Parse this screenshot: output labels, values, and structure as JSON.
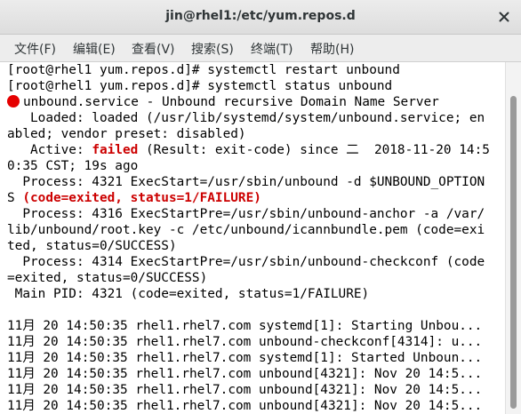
{
  "window": {
    "title": "jin@rhel1:/etc/yum.repos.d",
    "close_icon": "close-icon"
  },
  "menu": {
    "items": [
      "文件(F)",
      "编辑(E)",
      "查看(V)",
      "搜索(S)",
      "终端(T)",
      "帮助(H)"
    ]
  },
  "terminal": {
    "lines": {
      "l0": "[root@rhel1 yum.repos.d]# systemctl restart unbound",
      "l1": "[root@rhel1 yum.repos.d]# systemctl status unbound",
      "l2_text": "unbound.service - Unbound recursive Domain Name Server",
      "l3": "   Loaded: loaded (/usr/lib/systemd/system/unbound.service; en",
      "l4": "abled; vendor preset: disabled)",
      "l5_pre": "   Active: ",
      "l5_status": "failed",
      "l5_post": " (Result: exit-code) since 二  2018-11-20 14:5",
      "l6": "0:35 CST; 19s ago",
      "l7": "  Process: 4321 ExecStart=/usr/sbin/unbound -d $UNBOUND_OPTION",
      "l8_pre": "S ",
      "l8_status": "(code=exited, status=1/FAILURE)",
      "l9": "  Process: 4316 ExecStartPre=/usr/sbin/unbound-anchor -a /var/",
      "l10": "lib/unbound/root.key -c /etc/unbound/icannbundle.pem (code=exi",
      "l11": "ted, status=0/SUCCESS)",
      "l12": "  Process: 4314 ExecStartPre=/usr/sbin/unbound-checkconf (code",
      "l13": "=exited, status=0/SUCCESS)",
      "l14": " Main PID: 4321 (code=exited, status=1/FAILURE)",
      "l15": "",
      "l16": "11月 20 14:50:35 rhel1.rhel7.com systemd[1]: Starting Unbou...",
      "l17": "11月 20 14:50:35 rhel1.rhel7.com unbound-checkconf[4314]: u...",
      "l18": "11月 20 14:50:35 rhel1.rhel7.com systemd[1]: Started Unboun...",
      "l19": "11月 20 14:50:35 rhel1.rhel7.com unbound[4321]: Nov 20 14:5...",
      "l20": "11月 20 14:50:35 rhel1.rhel7.com unbound[4321]: Nov 20 14:5...",
      "l21": "11月 20 14:50:35 rhel1.rhel7.com unbound[4321]: Nov 20 14:5..."
    }
  },
  "colors": {
    "failed_red": "#cc0000",
    "status_dot": "#e50000"
  }
}
